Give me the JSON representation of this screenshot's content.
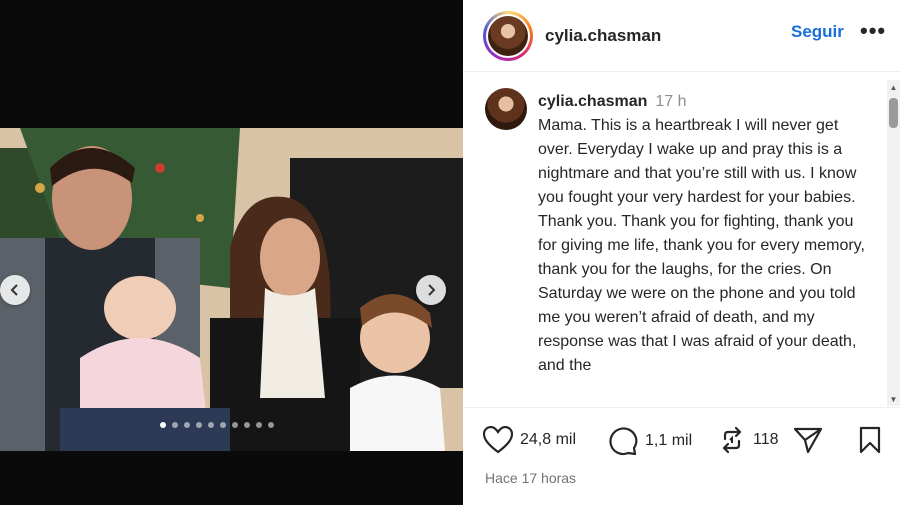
{
  "header": {
    "username": "cylia.chasman",
    "follow_label": "Seguir",
    "more_label": "•••"
  },
  "comment": {
    "username": "cylia.chasman",
    "time": "17 h",
    "text": "Mama. This is a heartbreak I will never get over. Everyday I wake up and pray this is a nightmare and that you’re still with us. I know you fought your very hardest for your babies. Thank you. Thank you for fighting, thank you for giving me life, thank you for every memory, thank you for the laughs, for the cries. On Saturday we were on the phone and you told me you weren’t afraid of death, and my response was that I was afraid of your death, and the"
  },
  "actions": {
    "likes": "24,8 mil",
    "comments": "1,1 mil",
    "reposts": "118",
    "posted": "Hace 17 horas"
  },
  "carousel": {
    "dot_count": 10,
    "active_index": 0
  },
  "icons": [
    "chevron-left-icon",
    "chevron-right-icon",
    "heart-icon",
    "comment-icon",
    "repost-icon",
    "send-icon",
    "bookmark-icon"
  ]
}
